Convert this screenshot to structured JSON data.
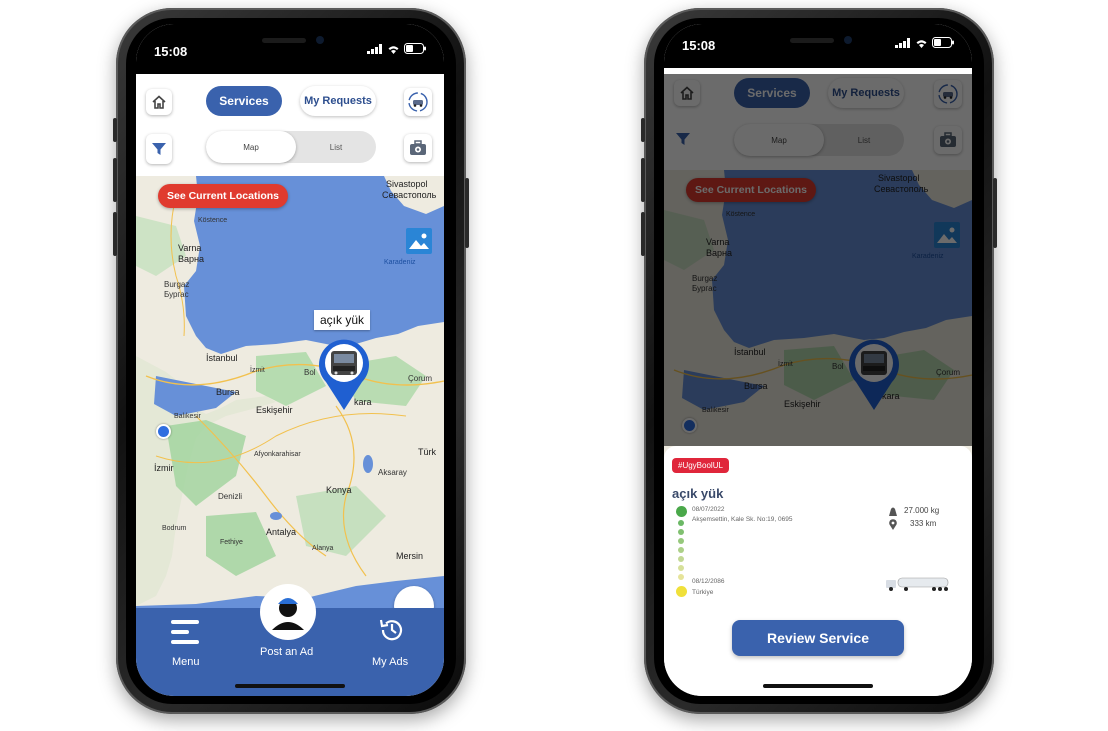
{
  "status_bar": {
    "time": "15:08"
  },
  "header": {
    "tab_services": "Services",
    "tab_requests": "My Requests",
    "view_map": "Map",
    "view_list": "List"
  },
  "map": {
    "see_locations": "See Current Locations",
    "callout": "açık yük",
    "labels": {
      "sivastopol": "Sivastopol",
      "sevastopol_cyr": "Севастополь",
      "kostence": "Köstence",
      "varna": "Varna",
      "varna_cyr": "Варна",
      "burgaz": "Burgaz",
      "burgaz_cyr": "Бургас",
      "karadeniz": "Karadeniz",
      "istanbul": "İstanbul",
      "izmit": "İzmit",
      "bolu": "Bol",
      "corum": "Çorum",
      "bursa": "Bursa",
      "balikesir": "Balıkesir",
      "eskisehir": "Eskişehir",
      "ankara": "kara",
      "afyon": "Afyonkarahisar",
      "turk": "Türk",
      "izmir": "İzmir",
      "aksaray": "Aksaray",
      "denizli": "Denizli",
      "konya": "Konya",
      "antalya": "Antalya",
      "bodrum": "Bodrum",
      "fethiye": "Fethiye",
      "alanya": "Alanya",
      "mersin": "Mersin"
    }
  },
  "bottom_nav": {
    "menu": "Menu",
    "post_ad": "Post an Ad",
    "my_ads": "My Ads"
  },
  "detail": {
    "tag": "#UgyBoolUL",
    "title": "açık yük",
    "start_date": "08/07/2022",
    "start_address": "Akşemsettin, Kale Sk. No:19, 0695",
    "end_date": "08/12/2086",
    "end_address": "Türkiye",
    "weight": "27.000 kg",
    "distance": "333 km",
    "review_button": "Review Service"
  },
  "colors": {
    "primary": "#3a62ad",
    "red": "#e03b2f",
    "tag_red": "#e0263b",
    "sea": "#6790d8"
  }
}
